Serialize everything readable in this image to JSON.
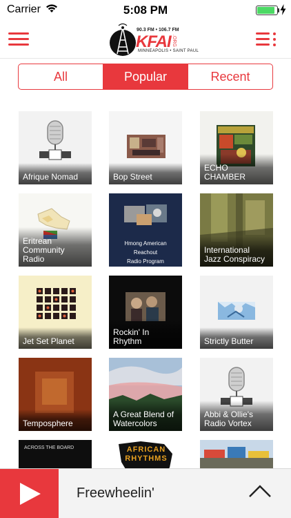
{
  "status_bar": {
    "carrier": "Carrier",
    "time": "5:08 PM",
    "battery_level": 0.9
  },
  "header": {
    "logo": {
      "frequencies": "90.3 FM • 106.7 FM",
      "name": "KFAI",
      "tld": ".ORG",
      "city": "MINNEAPOLIS • SAINT PAUL"
    }
  },
  "tabs": [
    {
      "label": "All",
      "selected": false
    },
    {
      "label": "Popular",
      "selected": true
    },
    {
      "label": "Recent",
      "selected": false
    }
  ],
  "shows": [
    {
      "title": "Afrique Nomad"
    },
    {
      "title": "Bop Street"
    },
    {
      "title": "ECHO CHAMBER"
    },
    {
      "title": "Eritrean Community Radio"
    },
    {
      "title": "Hmong American Reachout Radio Program",
      "artwork_text": [
        "Hmong American",
        "Reachout",
        "Radio Program"
      ]
    },
    {
      "title": "International Jazz Conspiracy"
    },
    {
      "title": "Jet Set Planet"
    },
    {
      "title": "Rockin' In Rhythm"
    },
    {
      "title": "Strictly Butter"
    },
    {
      "title": "Temposphere"
    },
    {
      "title": "A Great Blend of Watercolors"
    },
    {
      "title": "Abbi & Ollie's Radio Vortex"
    },
    {
      "title": "",
      "artwork_text": [
        "ACROSS THE BOARD"
      ]
    },
    {
      "title": "",
      "artwork_text": [
        "AFRICAN",
        "RHYTHMS"
      ]
    },
    {
      "title": ""
    }
  ],
  "player": {
    "now_playing": "Freewheelin'"
  },
  "colors": {
    "accent": "#e8383d",
    "player_background": "#f3f3f3"
  },
  "icons": {
    "menu": "hamburger-menu-icon",
    "list": "list-menu-icon",
    "play": "play-icon",
    "expand": "chevron-up-icon"
  }
}
